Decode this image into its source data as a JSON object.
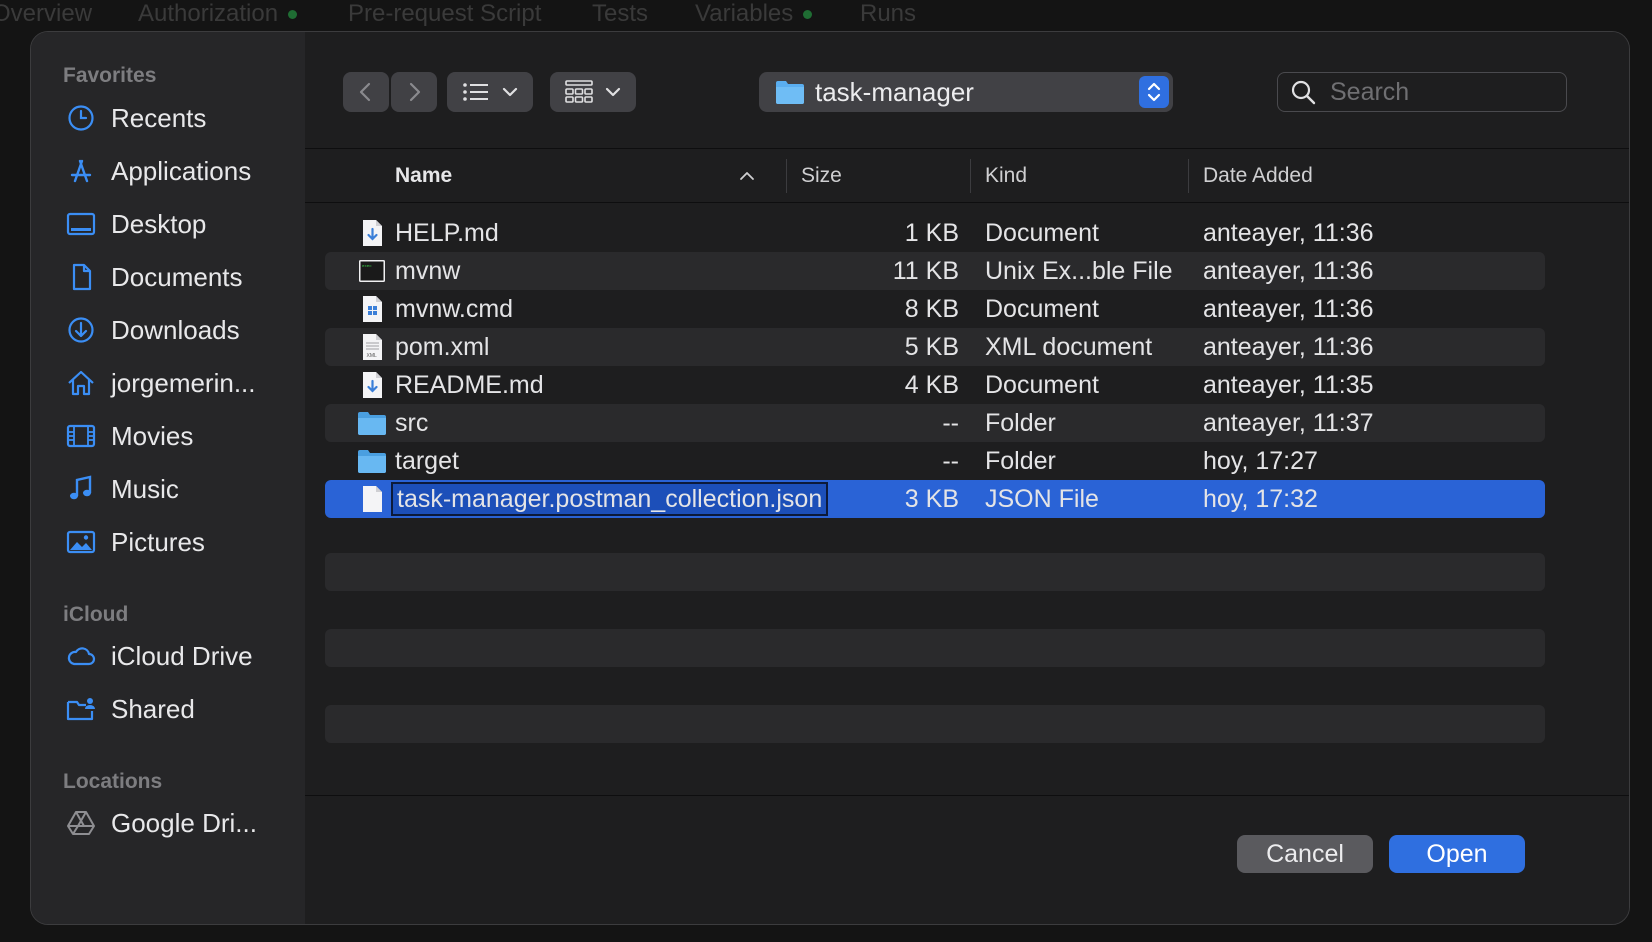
{
  "background": {
    "tabs": [
      {
        "label": "Overview",
        "dot": false
      },
      {
        "label": "Authorization",
        "dot": true
      },
      {
        "label": "Pre-request Script",
        "dot": false
      },
      {
        "label": "Tests",
        "dot": false
      },
      {
        "label": "Variables",
        "dot": true
      },
      {
        "label": "Runs",
        "dot": false
      }
    ]
  },
  "sidebar": {
    "favorites_header": "Favorites",
    "favorites": [
      {
        "label": "Recents",
        "icon": "clock-icon"
      },
      {
        "label": "Applications",
        "icon": "applications-icon"
      },
      {
        "label": "Desktop",
        "icon": "desktop-icon"
      },
      {
        "label": "Documents",
        "icon": "document-icon"
      },
      {
        "label": "Downloads",
        "icon": "downloads-icon"
      },
      {
        "label": "jorgemerin...",
        "icon": "home-icon"
      },
      {
        "label": "Movies",
        "icon": "film-icon"
      },
      {
        "label": "Music",
        "icon": "music-note-icon"
      },
      {
        "label": "Pictures",
        "icon": "pictures-icon"
      }
    ],
    "icloud_header": "iCloud",
    "icloud": [
      {
        "label": "iCloud Drive",
        "icon": "cloud-icon"
      },
      {
        "label": "Shared",
        "icon": "shared-folder-icon"
      }
    ],
    "locations_header": "Locations",
    "locations": [
      {
        "label": "Google Dri...",
        "icon": "google-drive-icon"
      }
    ]
  },
  "toolbar": {
    "current_folder": "task-manager",
    "search_placeholder": "Search"
  },
  "columns": {
    "name": "Name",
    "size": "Size",
    "kind": "Kind",
    "date_added": "Date Added"
  },
  "files": [
    {
      "name": "HELP.md",
      "size": "1 KB",
      "kind": "Document",
      "date": "anteayer, 11:36",
      "icon": "markdown-file-icon"
    },
    {
      "name": "mvnw",
      "size": "11 KB",
      "kind": "Unix Ex...ble File",
      "date": "anteayer, 11:36",
      "icon": "terminal-file-icon"
    },
    {
      "name": "mvnw.cmd",
      "size": "8 KB",
      "kind": "Document",
      "date": "anteayer, 11:36",
      "icon": "windows-file-icon"
    },
    {
      "name": "pom.xml",
      "size": "5 KB",
      "kind": "XML document",
      "date": "anteayer, 11:36",
      "icon": "xml-file-icon"
    },
    {
      "name": "README.md",
      "size": "4 KB",
      "kind": "Document",
      "date": "anteayer, 11:35",
      "icon": "markdown-file-icon"
    },
    {
      "name": "src",
      "size": "--",
      "kind": "Folder",
      "date": "anteayer, 11:37",
      "icon": "folder-icon"
    },
    {
      "name": "target",
      "size": "--",
      "kind": "Folder",
      "date": "hoy, 17:27",
      "icon": "folder-icon"
    },
    {
      "name": "task-manager.postman_collection.json",
      "size": "3 KB",
      "kind": "JSON File",
      "date": "hoy, 17:32",
      "icon": "json-file-icon",
      "selected": true
    }
  ],
  "buttons": {
    "cancel": "Cancel",
    "open": "Open"
  },
  "colors": {
    "accent": "#2f6fe0",
    "selection": "#2a63d6",
    "sidebar_icon": "#3b8ef5"
  }
}
